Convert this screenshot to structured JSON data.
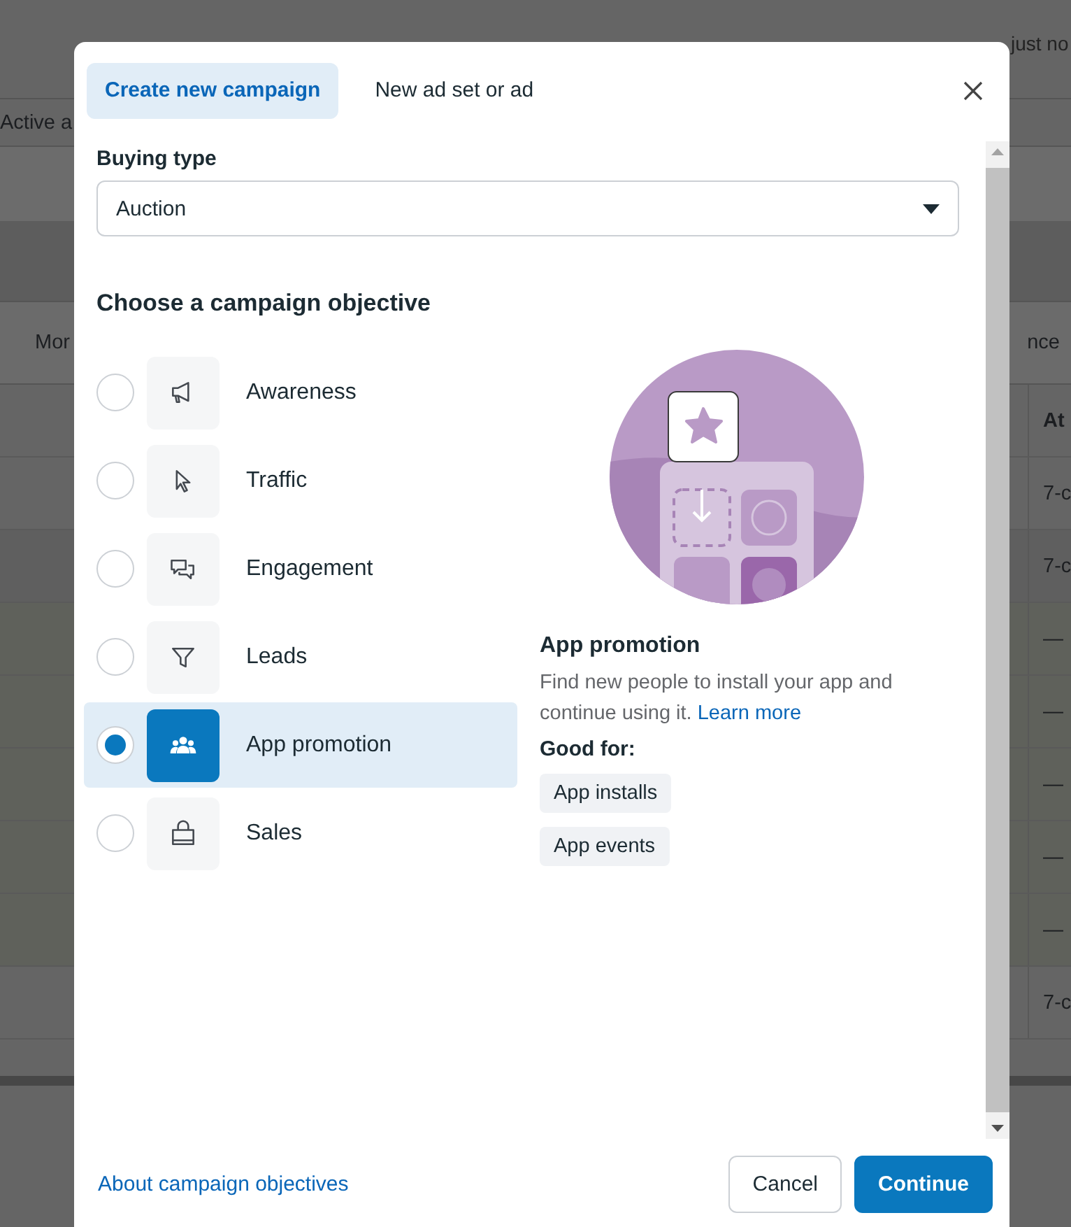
{
  "background": {
    "status": "just no",
    "filter": "Active a",
    "column_left": "Mor",
    "column_right": "nce",
    "header": "At",
    "cells": [
      "7-c",
      "7-c",
      "—",
      "—",
      "—",
      "—",
      "—",
      "7-c"
    ]
  },
  "dialog": {
    "tabs": [
      {
        "label": "Create new campaign",
        "selected": true
      },
      {
        "label": "New ad set or ad",
        "selected": false
      }
    ],
    "buying_type": {
      "label": "Buying type",
      "value": "Auction"
    },
    "objective_heading": "Choose a campaign objective",
    "objectives": [
      {
        "label": "Awareness",
        "selected": false
      },
      {
        "label": "Traffic",
        "selected": false
      },
      {
        "label": "Engagement",
        "selected": false
      },
      {
        "label": "Leads",
        "selected": false
      },
      {
        "label": "App promotion",
        "selected": true
      },
      {
        "label": "Sales",
        "selected": false
      }
    ],
    "detail": {
      "title": "App promotion",
      "description": "Find new people to install your app and continue using it.",
      "link": "Learn more",
      "good_for_label": "Good for:",
      "tags": [
        "App installs",
        "App events"
      ]
    },
    "footer": {
      "link": "About campaign objectives",
      "buttons": [
        {
          "label": "Cancel",
          "kind": "secondary"
        },
        {
          "label": "Continue",
          "kind": "primary"
        }
      ]
    }
  }
}
